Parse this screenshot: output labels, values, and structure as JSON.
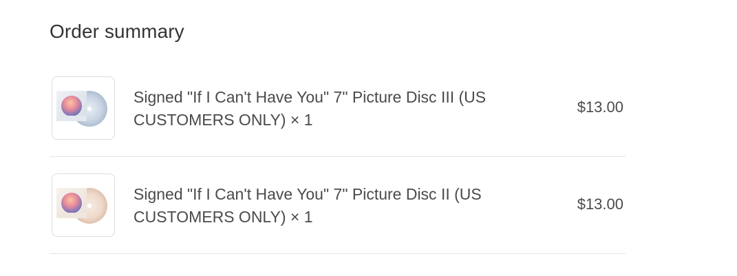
{
  "order_summary": {
    "title": "Order summary",
    "items": [
      {
        "name": "Signed \"If I Can't Have You\" 7\" Picture Disc III (US CUSTOMERS ONLY) × 1",
        "price": "$13.00",
        "thumbnail": "picture-disc-iii-image",
        "disc_color": "#c9d6e6"
      },
      {
        "name": "Signed \"If I Can't Have You\" 7\" Picture Disc II (US CUSTOMERS ONLY) × 1",
        "price": "$13.00",
        "thumbnail": "picture-disc-ii-image",
        "disc_color": "#efd9cb"
      }
    ]
  }
}
